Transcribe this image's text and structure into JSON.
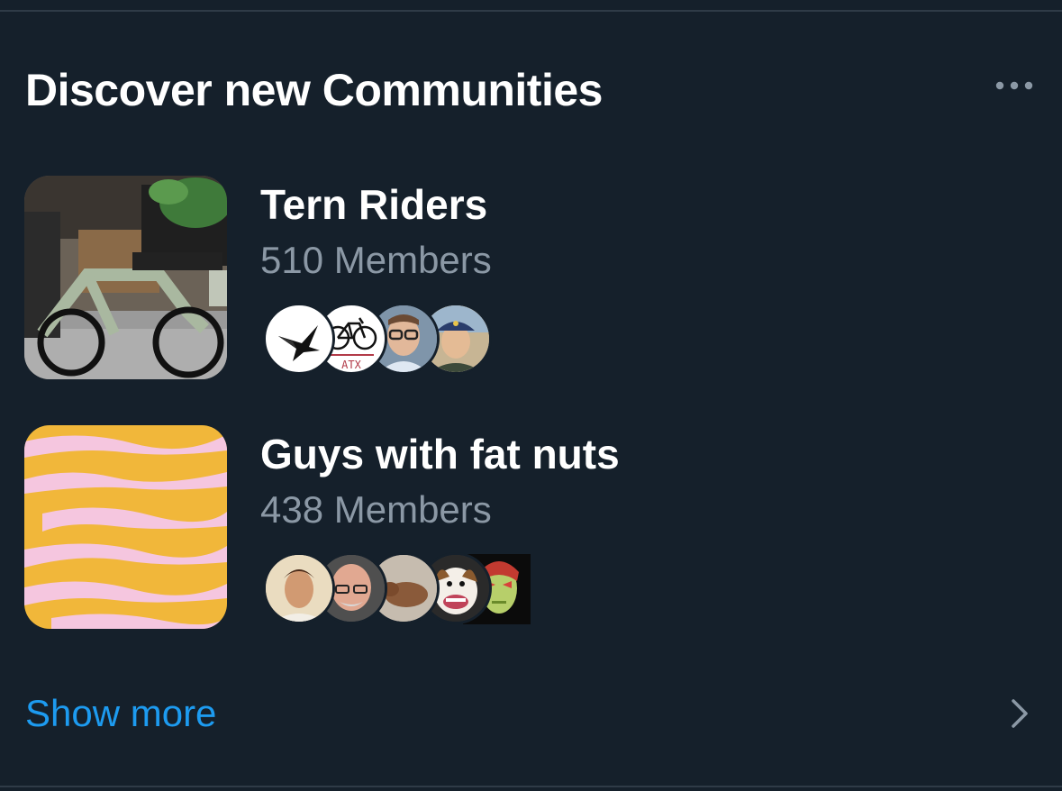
{
  "header": {
    "title": "Discover new Communities",
    "more_icon": "more-horizontal-icon"
  },
  "communities": [
    {
      "name": "Tern Riders",
      "members": "510 Members",
      "thumbnail": "cargo-bike-photo",
      "avatars": [
        "origami-bird-logo",
        "atx-bicycle-logo",
        "man-with-glasses-photo",
        "woman-in-cap-photo"
      ]
    },
    {
      "name": "Guys with fat nuts",
      "members": "438 Members",
      "thumbnail": "yellow-pink-stripes-art",
      "avatars": [
        "man-portrait-painting",
        "bald-man-photo",
        "sleeping-dog-photo",
        "smiling-dog-photo",
        "green-mask-face"
      ]
    }
  ],
  "footer": {
    "show_more_label": "Show more",
    "chevron_icon": "chevron-right-icon"
  },
  "colors": {
    "background": "#15202b",
    "accent": "#1d9bf0",
    "secondary_text": "#8b98a5",
    "divider": "#2f3b47"
  }
}
